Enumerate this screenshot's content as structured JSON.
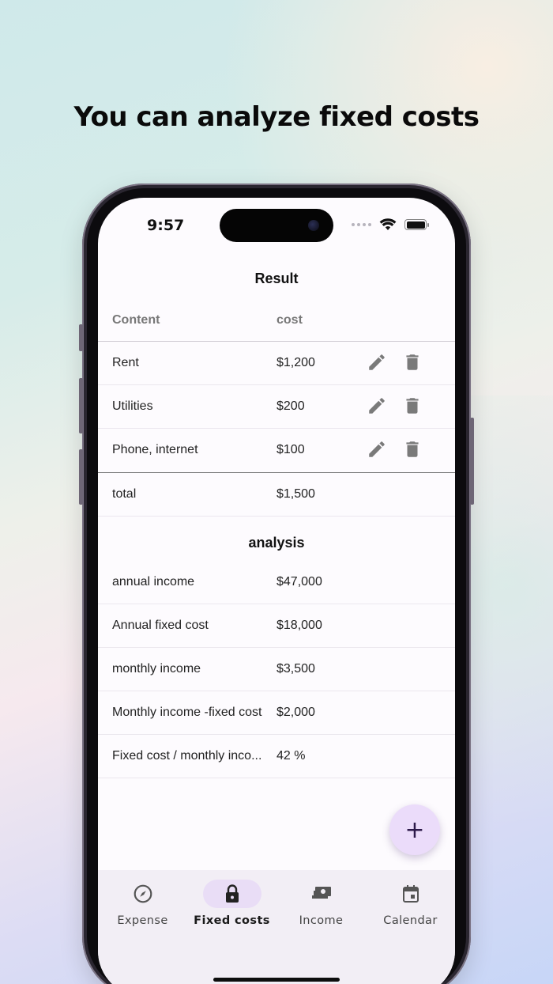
{
  "headline": "You can analyze fixed costs",
  "status": {
    "time": "9:57"
  },
  "result": {
    "title": "Result",
    "columns": {
      "content": "Content",
      "cost": "cost"
    },
    "rows": [
      {
        "content": "Rent",
        "cost": "$1,200"
      },
      {
        "content": "Utilities",
        "cost": "$200"
      },
      {
        "content": "Phone, internet",
        "cost": "$100"
      }
    ],
    "total": {
      "label": "total",
      "value": "$1,500"
    }
  },
  "analysis": {
    "title": "analysis",
    "rows": [
      {
        "label": "annual income",
        "value": "$47,000"
      },
      {
        "label": "Annual fixed cost",
        "value": "$18,000"
      },
      {
        "label": "monthly income",
        "value": "$3,500"
      },
      {
        "label": "Monthly income -fixed cost",
        "value": "$2,000"
      },
      {
        "label": "Fixed cost / monthly inco...",
        "value": "42 %"
      }
    ]
  },
  "fab": {
    "label": "+"
  },
  "nav": {
    "items": [
      {
        "label": "Expense",
        "icon": "compass-icon"
      },
      {
        "label": "Fixed costs",
        "icon": "lock-icon",
        "active": true
      },
      {
        "label": "Income",
        "icon": "cash-icon"
      },
      {
        "label": "Calendar",
        "icon": "calendar-icon"
      }
    ]
  },
  "colors": {
    "accent": "#e9ddf6",
    "fab": "#ebdcfa",
    "icon": "#7a7a7a"
  }
}
